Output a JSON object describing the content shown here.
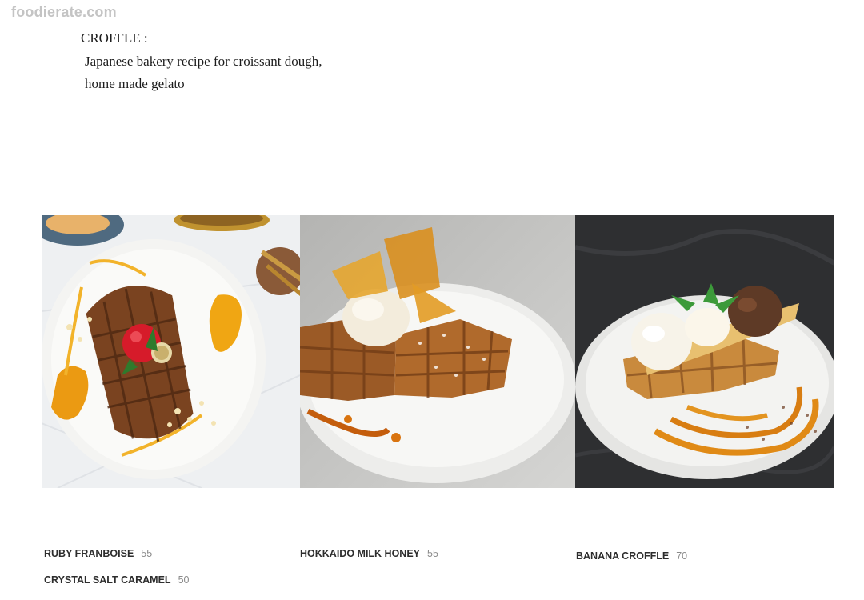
{
  "watermark": "foodierate.com",
  "intro": {
    "heading": "CROFFLE :",
    "line1": "Japanese bakery recipe for croissant dough,",
    "line2": "home made gelato"
  },
  "photos": [
    {
      "subject": "ruby-franboise-croffle"
    },
    {
      "subject": "hokkaido-milk-honey-croffle"
    },
    {
      "subject": "banana-croffle"
    }
  ],
  "menu": [
    {
      "name": "RUBY FRANBOISE",
      "price": "55"
    },
    {
      "name": "CRYSTAL SALT CARAMEL",
      "price": "50"
    },
    {
      "name": "HOKKAIDO MILK HONEY",
      "price": "55"
    },
    {
      "name": "BANANA CROFFLE",
      "price": "70"
    }
  ],
  "colors": {
    "caramel": "#e8a21e",
    "waffle": "#8a4e25",
    "dark_background": "#2e2f31"
  }
}
